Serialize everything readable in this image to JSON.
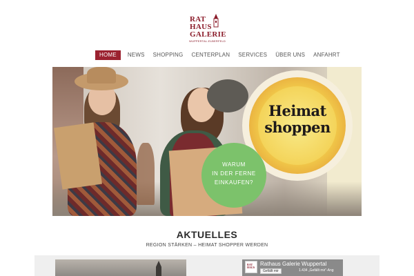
{
  "logo": {
    "line1": "RAT",
    "line2": "HAUS",
    "line3": "GALERIE",
    "subtitle": "WUPPERTAL-ELBERFELD"
  },
  "nav": {
    "items": [
      {
        "label": "HOME",
        "active": true
      },
      {
        "label": "NEWS"
      },
      {
        "label": "SHOPPING"
      },
      {
        "label": "CENTERPLAN"
      },
      {
        "label": "SERVICES"
      },
      {
        "label": "ÜBER UNS"
      },
      {
        "label": "ANFAHRT"
      }
    ]
  },
  "hero": {
    "headline_line1": "Heimat",
    "headline_line2": "shoppen",
    "green_line1": "WARUM",
    "green_line2": "IN DER FERNE",
    "green_line3": "EINKAUFEN?"
  },
  "aktuelles": {
    "title": "AKTUELLES",
    "subtitle": "REGION STÄRKEN – HEIMAT SHOPPER WERDEN"
  },
  "facebook": {
    "page_name": "Rathaus Galerie Wuppertal",
    "like_label": "Gefällt mir",
    "count_text": "1.434 „Gefällt mir“-Ang"
  },
  "colors": {
    "brand": "#9b2230",
    "green": "#7cc26b",
    "yellow": "#f4d45a"
  }
}
